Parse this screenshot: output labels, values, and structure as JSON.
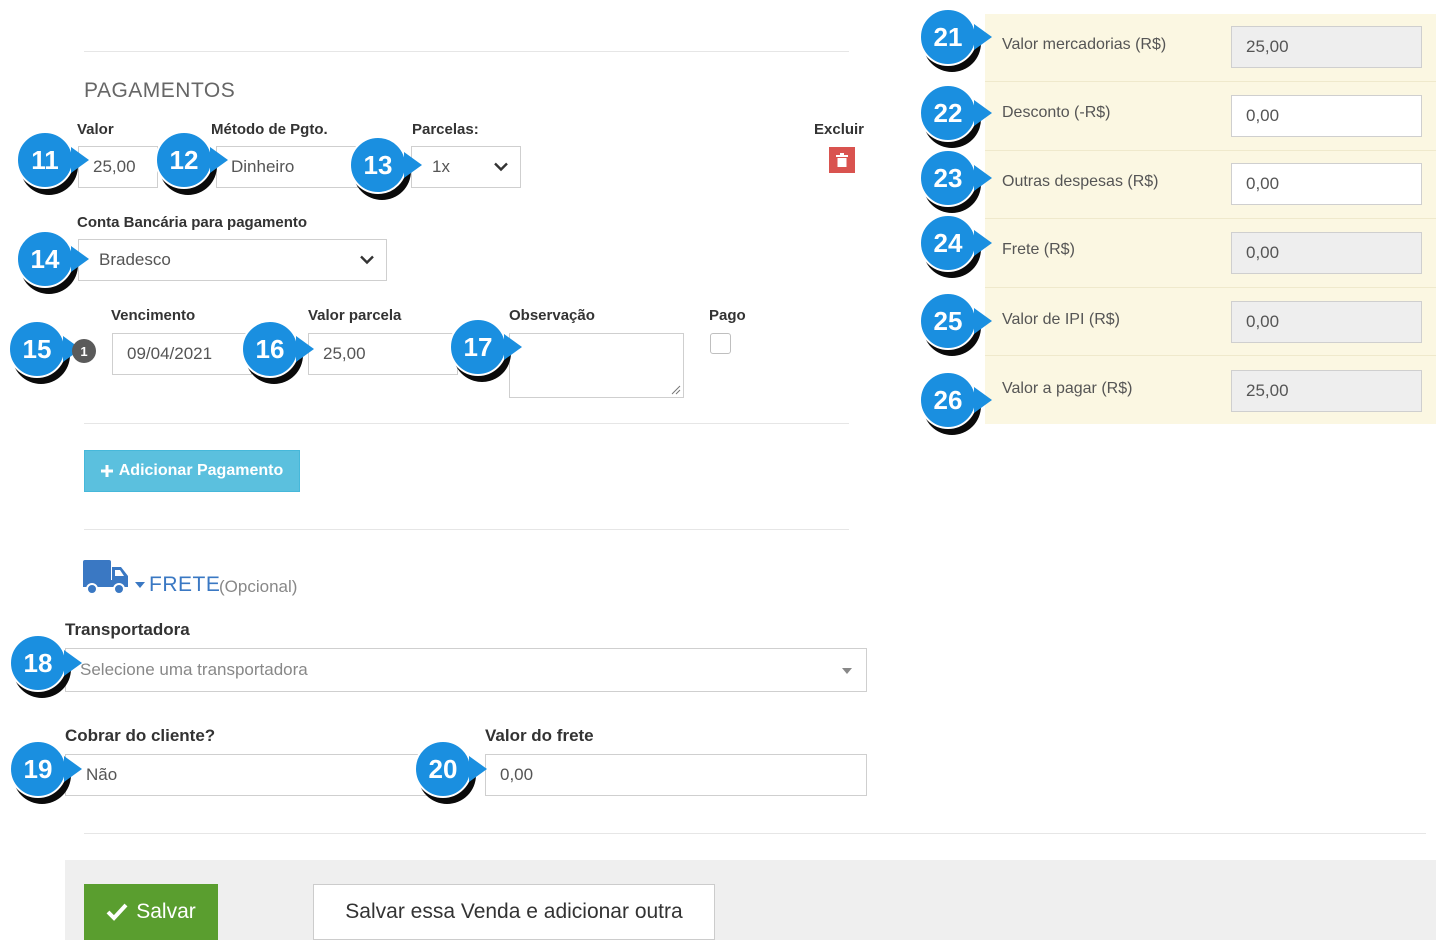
{
  "payments": {
    "section_title": "PAGAMENTOS",
    "valor_label": "Valor",
    "valor_value": "25,00",
    "metodo_label": "Método de Pgto.",
    "metodo_value": "Dinheiro",
    "parcelas_label": "Parcelas:",
    "parcelas_value": "1x",
    "excluir_label": "Excluir",
    "conta_label": "Conta Bancária para pagamento",
    "conta_value": "Bradesco",
    "installment_number": "1",
    "vencimento_label": "Vencimento",
    "vencimento_value": "09/04/2021",
    "valor_parcela_label": "Valor parcela",
    "valor_parcela_value": "25,00",
    "observacao_label": "Observação",
    "observacao_value": "",
    "pago_label": "Pago",
    "add_button_label": "Adicionar Pagamento"
  },
  "freight": {
    "section_title": "FRETE",
    "optional_label": "(Opcional)",
    "transportadora_label": "Transportadora",
    "transportadora_placeholder": "Selecione uma transportadora",
    "cobrar_label": "Cobrar do cliente?",
    "cobrar_value": "Não",
    "valor_frete_label": "Valor do frete",
    "valor_frete_value": "0,00"
  },
  "summary": {
    "rows": [
      {
        "label": "Valor mercadorias (R$)",
        "value": "25,00",
        "readonly": true
      },
      {
        "label": "Desconto (-R$)",
        "value": "0,00",
        "readonly": false
      },
      {
        "label": "Outras despesas (R$)",
        "value": "0,00",
        "readonly": false
      },
      {
        "label": "Frete (R$)",
        "value": "0,00",
        "readonly": true
      },
      {
        "label": "Valor de IPI (R$)",
        "value": "0,00",
        "readonly": true
      },
      {
        "label": "Valor a pagar (R$)",
        "value": "25,00",
        "readonly": true
      }
    ]
  },
  "footer": {
    "save_label": "Salvar",
    "save_and_new_label": "Salvar essa Venda e adicionar outra"
  },
  "callouts": [
    "11",
    "12",
    "13",
    "14",
    "15",
    "16",
    "17",
    "18",
    "19",
    "20",
    "21",
    "22",
    "23",
    "24",
    "25",
    "26"
  ],
  "colors": {
    "callout": "#1a8fe0",
    "add_button": "#5bc0de",
    "save_button": "#5a9e2f",
    "delete_button": "#d9534f",
    "summary_bg": "#fbf7e2",
    "truck_icon": "#3a78c3"
  },
  "icons": {
    "delete": "trash-icon",
    "add": "plus-icon",
    "save": "check-icon",
    "freight": "truck-icon",
    "dropdown": "chevron-down-icon"
  }
}
